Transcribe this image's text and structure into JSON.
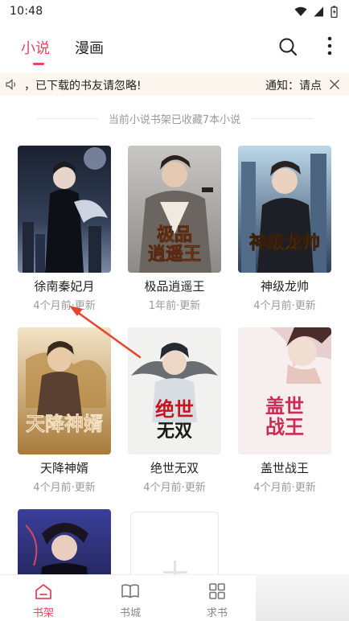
{
  "status": {
    "time": "10:48"
  },
  "header": {
    "tabs": [
      {
        "label": "小说",
        "active": true
      },
      {
        "label": "漫画",
        "active": false
      }
    ],
    "icons": {
      "search": "search-icon",
      "more": "more-vertical-icon"
    }
  },
  "notice": {
    "text": "，已下载的书友请忽略!",
    "label": "通知：请点",
    "icons": {
      "speaker": "speaker-icon",
      "close": "close-icon"
    }
  },
  "shelf": {
    "caption": "当前小说书架已收藏7本小说",
    "books": [
      {
        "title": "徐南秦妃月",
        "meta": "4个月前·更新",
        "cover_text": ""
      },
      {
        "title": "极品逍遥王",
        "meta": "1年前·更新",
        "cover_text": "极品逍遥王"
      },
      {
        "title": "神级龙帅",
        "meta": "4个月前·更新",
        "cover_text": "神级龙帅"
      },
      {
        "title": "天降神婿",
        "meta": "4个月前·更新",
        "cover_text": "天降神婿"
      },
      {
        "title": "绝世无双",
        "meta": "4个月前·更新",
        "cover_text": "绝世无双"
      },
      {
        "title": "盖世战王",
        "meta": "4个月前·更新",
        "cover_text": "盖世战王"
      },
      {
        "title": "",
        "meta": "",
        "cover_text": ""
      }
    ],
    "add_icon": "plus-icon"
  },
  "bottom_nav": [
    {
      "label": "书架",
      "icon": "bookshelf-icon",
      "active": true
    },
    {
      "label": "书城",
      "icon": "book-icon",
      "active": false
    },
    {
      "label": "求书",
      "icon": "grid-icon",
      "active": false
    }
  ],
  "colors": {
    "accent": "#e6455c",
    "notice_bg": "#fdf6ef",
    "muted": "#999999"
  }
}
